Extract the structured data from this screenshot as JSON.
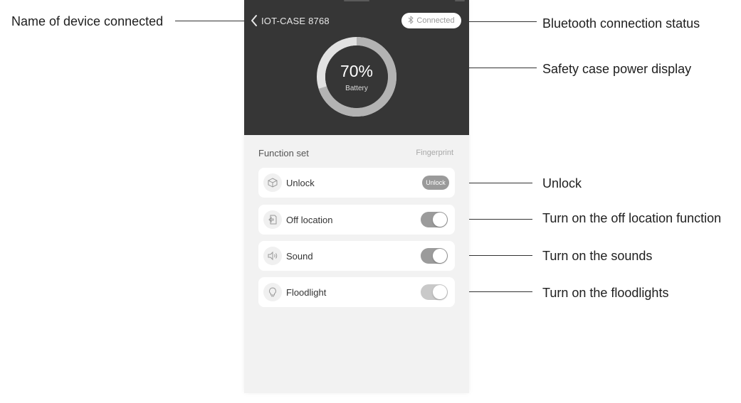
{
  "device": {
    "back_icon": "chevron-left-icon",
    "name": "IOT-CASE 8768",
    "connection_icon": "bluetooth-icon",
    "connection_status": "Connected"
  },
  "battery": {
    "percent": 70,
    "percent_text": "70%",
    "label": "Battery"
  },
  "functions": {
    "title": "Function set",
    "link": "Fingerprint",
    "items": [
      {
        "label": "Unlock",
        "icon": "unlock-box-icon",
        "control": "button",
        "button_label": "Unlock"
      },
      {
        "label": "Off location",
        "icon": "location-off-icon",
        "control": "toggle",
        "on": true
      },
      {
        "label": "Sound",
        "icon": "speaker-icon",
        "control": "toggle",
        "on": true
      },
      {
        "label": "Floodlight",
        "icon": "lightbulb-icon",
        "control": "toggle",
        "on": true
      }
    ]
  },
  "annotations": {
    "device_name": "Name of device connected",
    "bluetooth_status": "Bluetooth connection status",
    "power_display": "Safety case power display",
    "unlock": "Unlock",
    "off_location": "Turn on the off location function",
    "sounds": "Turn on the sounds",
    "floodlights": "Turn on the floodlights"
  },
  "colors": {
    "header_bg": "#363636",
    "ring_track": "#e2e2e2",
    "ring_fill": "#b3b3b3",
    "panel_bg": "#f2f2f2",
    "toggle_on": "#9b9b9b"
  }
}
